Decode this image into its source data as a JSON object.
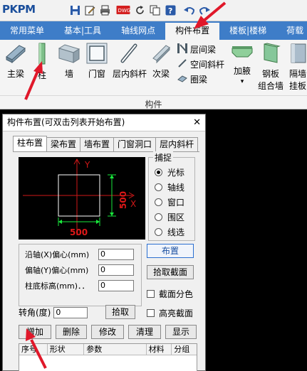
{
  "app": {
    "logo_text": "PKPM"
  },
  "quick_toolbar": [
    "save-icon",
    "edit-icon",
    "print-icon",
    "dwg-icon",
    "refresh-icon",
    "copy-icon",
    "help-icon",
    "undo-icon",
    "redo-icon"
  ],
  "tabs": [
    {
      "label": "常用菜单"
    },
    {
      "label": "基本|工具"
    },
    {
      "label": "轴线网点"
    },
    {
      "label": "构件布置",
      "active": true
    },
    {
      "label": "楼板|楼梯"
    },
    {
      "label": "荷载"
    }
  ],
  "ribbon": {
    "group_label": "构件",
    "buttons": {
      "main_beam": "主梁",
      "column": "柱",
      "wall": "墙",
      "door_window": "门窗",
      "interlayer_brace": "层内斜杆",
      "secondary_beam": "次梁",
      "layer_beam": "层间梁",
      "space_brace": "空间斜杆",
      "ring_beam": "圈梁",
      "haunch": "加腋",
      "steel_plate_wall_1": "钢板",
      "steel_plate_wall_2": "组合墙",
      "partition_1": "隔墙",
      "partition_2": "挂板"
    }
  },
  "dialog": {
    "title": "构件布置(可双击列表开始布置)",
    "close": "✕",
    "tabs": [
      "柱布置",
      "梁布置",
      "墙布置",
      "门窗洞口",
      "层内斜杆"
    ],
    "preview": {
      "axis_y": "Y",
      "axis_x": "X",
      "dim_width": "500",
      "dim_height": "500"
    },
    "snap": {
      "legend": "捕捉",
      "options": [
        "光标",
        "轴线",
        "窗口",
        "围区",
        "线选"
      ],
      "selected": "光标"
    },
    "params": [
      {
        "label": "沿轴(X)偏心(mm)",
        "value": "0"
      },
      {
        "label": "偏轴(Y)偏心(mm)",
        "value": "0"
      },
      {
        "label": "柱底标高(mm)．．",
        "value": "0"
      }
    ],
    "angle": {
      "label": "转角(度)",
      "value": "0",
      "pick_label": "拾取"
    },
    "side_buttons": {
      "layout": "布置",
      "pick_section": "拾取截面"
    },
    "checks": {
      "section_color": "截面分色",
      "highlight_section": "高亮截面"
    },
    "actions": {
      "add": "增加",
      "delete": "删除",
      "modify": "修改",
      "clean": "清理",
      "show": "显示"
    },
    "table_headers": [
      "序号",
      "形状",
      "参数",
      "材料",
      "分组"
    ]
  },
  "colors": {
    "tab_bar": "#3e7dc8",
    "canvas": "#000000",
    "arrow": "#e0182a",
    "dim_green": "#19e83c",
    "dim_red": "#e01818"
  }
}
